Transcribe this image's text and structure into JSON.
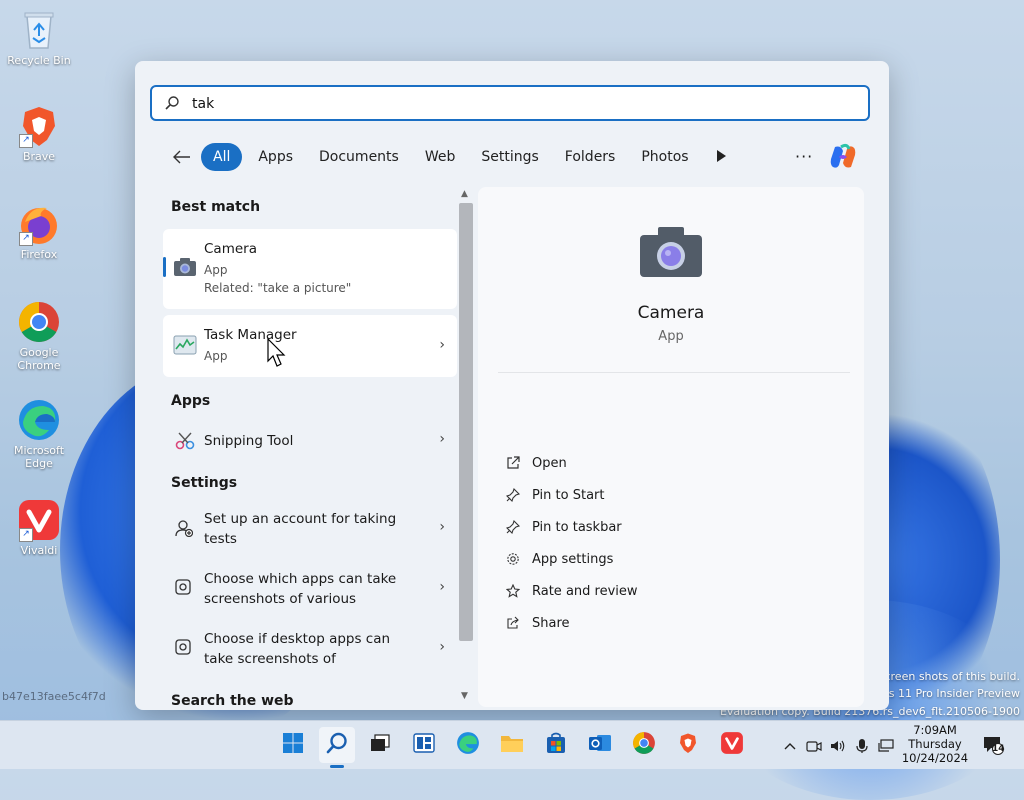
{
  "desktop": {
    "icons": [
      {
        "label": "Recycle Bin"
      },
      {
        "label": "Brave"
      },
      {
        "label": "Firefox"
      },
      {
        "label": "Google Chrome"
      },
      {
        "label": "Microsoft Edge"
      },
      {
        "label": "Vivaldi"
      }
    ],
    "watermark_id": "b47e13faee5c4f7d",
    "eval_line1": "screen shots of this build.",
    "eval_line2": "ws 11 Pro Insider Preview",
    "eval_line3": "Evaluation copy. Build 21376.rs_dev6_flt.210506-1900"
  },
  "search": {
    "query": "tak",
    "filters": [
      "All",
      "Apps",
      "Documents",
      "Web",
      "Settings",
      "Folders",
      "Photos"
    ],
    "active_filter": "All"
  },
  "results": {
    "best_match_header": "Best match",
    "best_match": {
      "title": "Camera",
      "type": "App",
      "related": "Related: \"take a picture\""
    },
    "second": {
      "title": "Task Manager",
      "type": "App"
    },
    "apps_header": "Apps",
    "apps": [
      {
        "title": "Snipping Tool"
      }
    ],
    "settings_header": "Settings",
    "settings": [
      {
        "line1": "Set up an account for taking",
        "line2": "tests"
      },
      {
        "line1": "Choose which apps can take",
        "line2": "screenshots of various"
      },
      {
        "line1": "Choose if desktop apps can",
        "line2": "take screenshots of"
      }
    ],
    "web_header": "Search the web"
  },
  "detail": {
    "name": "Camera",
    "type": "App",
    "actions": [
      "Open",
      "Pin to Start",
      "Pin to taskbar",
      "App settings",
      "Rate and review",
      "Share"
    ]
  },
  "taskbar": {
    "time": "7:09AM",
    "day": "Thursday",
    "date": "10/24/2024",
    "notifications": "14"
  },
  "colors": {
    "accent": "#1a6fc4"
  }
}
